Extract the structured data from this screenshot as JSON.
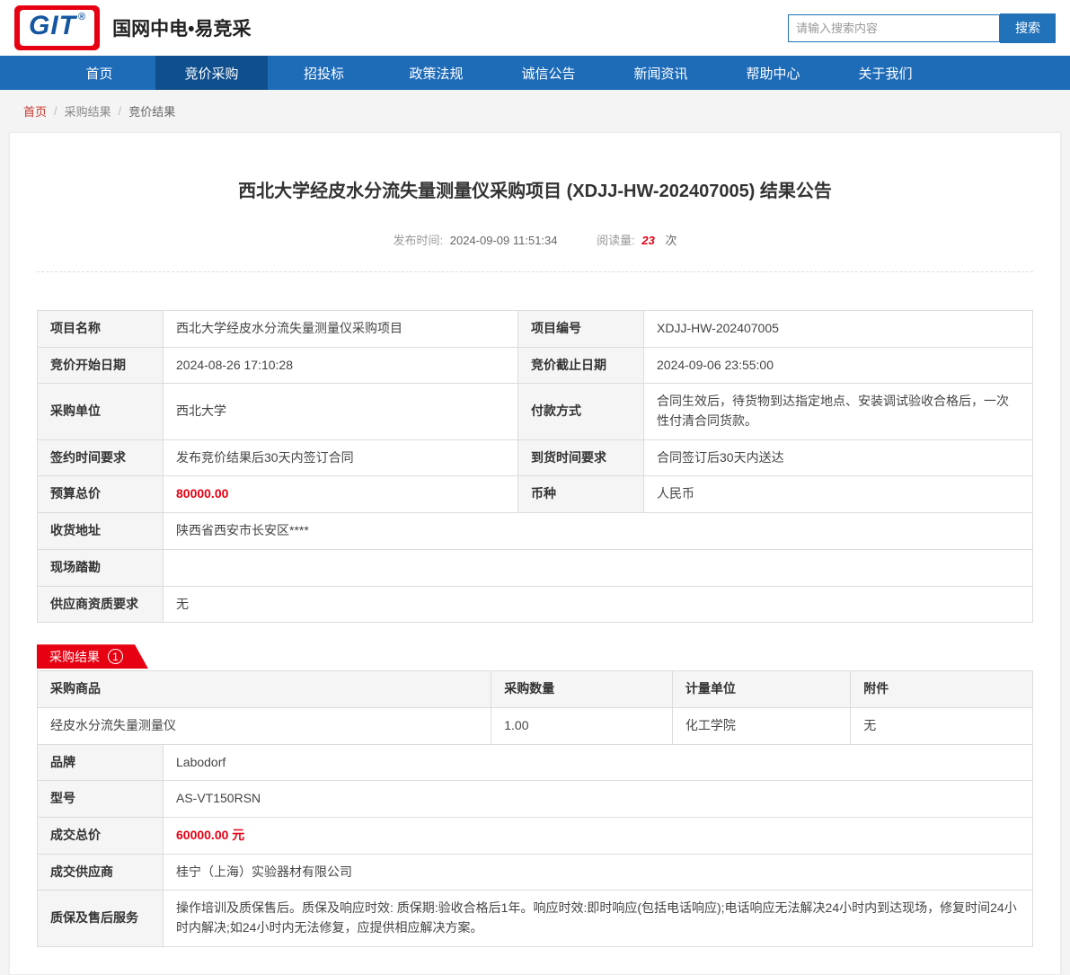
{
  "header": {
    "logo_text": "GIT",
    "logo_reg": "®",
    "site_title": "国网中电•易竞采",
    "search": {
      "placeholder": "请输入搜索内容",
      "button_label": "搜索"
    }
  },
  "nav": {
    "items": [
      "首页",
      "竞价采购",
      "招投标",
      "政策法规",
      "诚信公告",
      "新闻资讯",
      "帮助中心",
      "关于我们"
    ],
    "active_item": "竞价采购"
  },
  "breadcrumb": {
    "items": [
      "首页",
      "采购结果",
      "竞价结果"
    ]
  },
  "announcement": {
    "title": "西北大学经皮水分流失量测量仪采购项目 (XDJJ-HW-202407005) 结果公告",
    "publish_label": "发布时间:",
    "publish_time": "2024-09-09 11:51:34",
    "views_label": "阅读量:",
    "views_count": "23",
    "views_unit": "次"
  },
  "project": {
    "name_label": "项目名称",
    "name": "西北大学经皮水分流失量测量仪采购项目",
    "code_label": "项目编号",
    "code": "XDJJ-HW-202407005",
    "start_label": "竞价开始日期",
    "start": "2024-08-26 17:10:28",
    "end_label": "竞价截止日期",
    "end": "2024-09-06 23:55:00",
    "buyer_label": "采购单位",
    "buyer": "西北大学",
    "payment_label": "付款方式",
    "payment": "合同生效后，待货物到达指定地点、安装调试验收合格后，一次性付清合同货款。",
    "sign_label": "签约时间要求",
    "sign": "发布竞价结果后30天内签订合同",
    "arrival_label": "到货时间要求",
    "arrival": "合同签订后30天内送达",
    "budget_label": "预算总价",
    "budget": "80000.00",
    "currency_label": "币种",
    "currency": "人民币",
    "address_label": "收货地址",
    "address": "陕西省西安市长安区****",
    "survey_label": "现场踏勘",
    "survey": "",
    "qualification_label": "供应商资质要求",
    "qualification": "无"
  },
  "result": {
    "ribbon_label": "采购结果",
    "ribbon_count": "1",
    "product_table": {
      "headers": [
        "采购商品",
        "采购数量",
        "计量单位",
        "附件"
      ],
      "rows": [
        [
          "经皮水分流失量测量仪",
          "1.00",
          "化工学院",
          "无"
        ]
      ]
    },
    "details": [
      {
        "label": "品牌",
        "value": "Labodorf"
      },
      {
        "label": "型号",
        "value": "AS-VT150RSN"
      },
      {
        "label": "成交总价",
        "value": "60000.00 元"
      },
      {
        "label": "成交供应商",
        "value": "桂宁（上海）实验器材有限公司"
      },
      {
        "label": "质保及售后服务",
        "value": "操作培训及质保售后。质保及响应时效: 质保期:验收合格后1年。响应时效:即时响应(包括电话响应);电话响应无法解决24小时内到达现场，修复时间24小时内解决;如24小时内无法修复，应提供相应解决方案。"
      }
    ]
  },
  "colors": {
    "brand_red": "#e60012",
    "nav_blue": "#1e6bb8",
    "nav_active_blue": "#0f4f8e",
    "price_red": "#e60012",
    "logo_blue": "#1456a0"
  }
}
